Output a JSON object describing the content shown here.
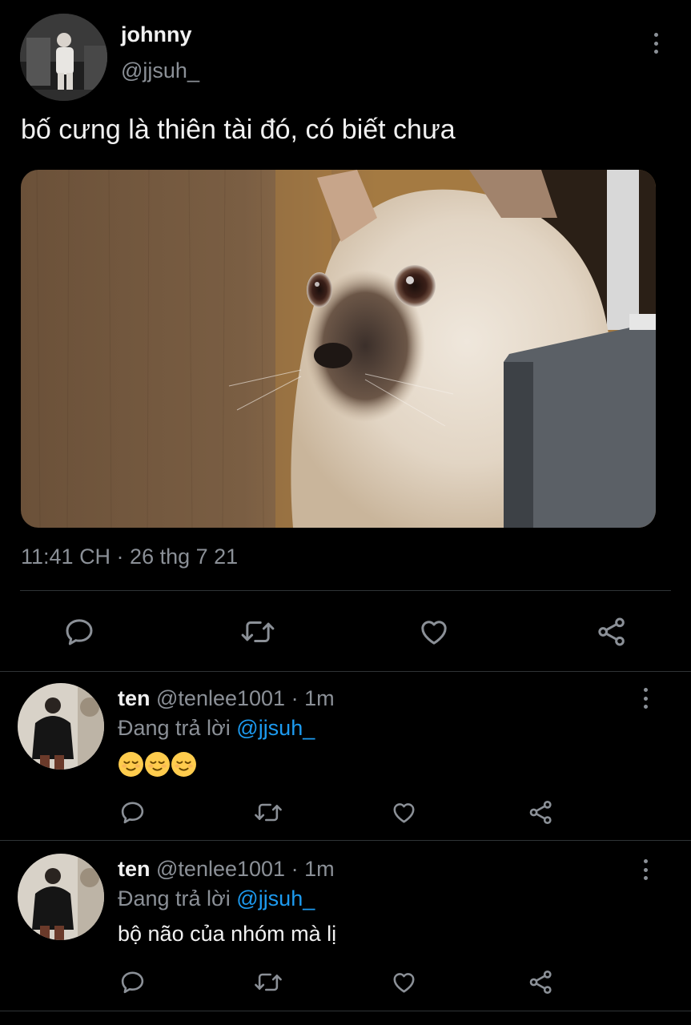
{
  "main_tweet": {
    "author_name": "johnny",
    "author_handle": "@jjsuh_",
    "text": "bố cưng là thiên tài đó, có biết chưa",
    "timestamp": "11:41 CH · 26 thg 7 21"
  },
  "replies": [
    {
      "author_name": "ten",
      "author_handle": "@tenlee1001",
      "time": "· 1m",
      "replying_prefix": "Đang trả lời",
      "replying_to": "@jjsuh_",
      "body": "😌😌😌"
    },
    {
      "author_name": "ten",
      "author_handle": "@tenlee1001",
      "time": "· 1m",
      "replying_prefix": "Đang trả lời",
      "replying_to": "@jjsuh_",
      "body": "bộ não của nhóm mà lị"
    }
  ],
  "colors": {
    "background": "#000000",
    "text_primary": "#f1f1f1",
    "text_secondary": "#8b9097",
    "link": "#1d9bf0",
    "divider": "#2f3336",
    "icon": "#8b9097"
  },
  "icons": {
    "reply": "speech-bubble-icon",
    "retweet": "retweet-icon",
    "like": "heart-icon",
    "share": "share-icon",
    "more": "more-vertical-icon"
  }
}
